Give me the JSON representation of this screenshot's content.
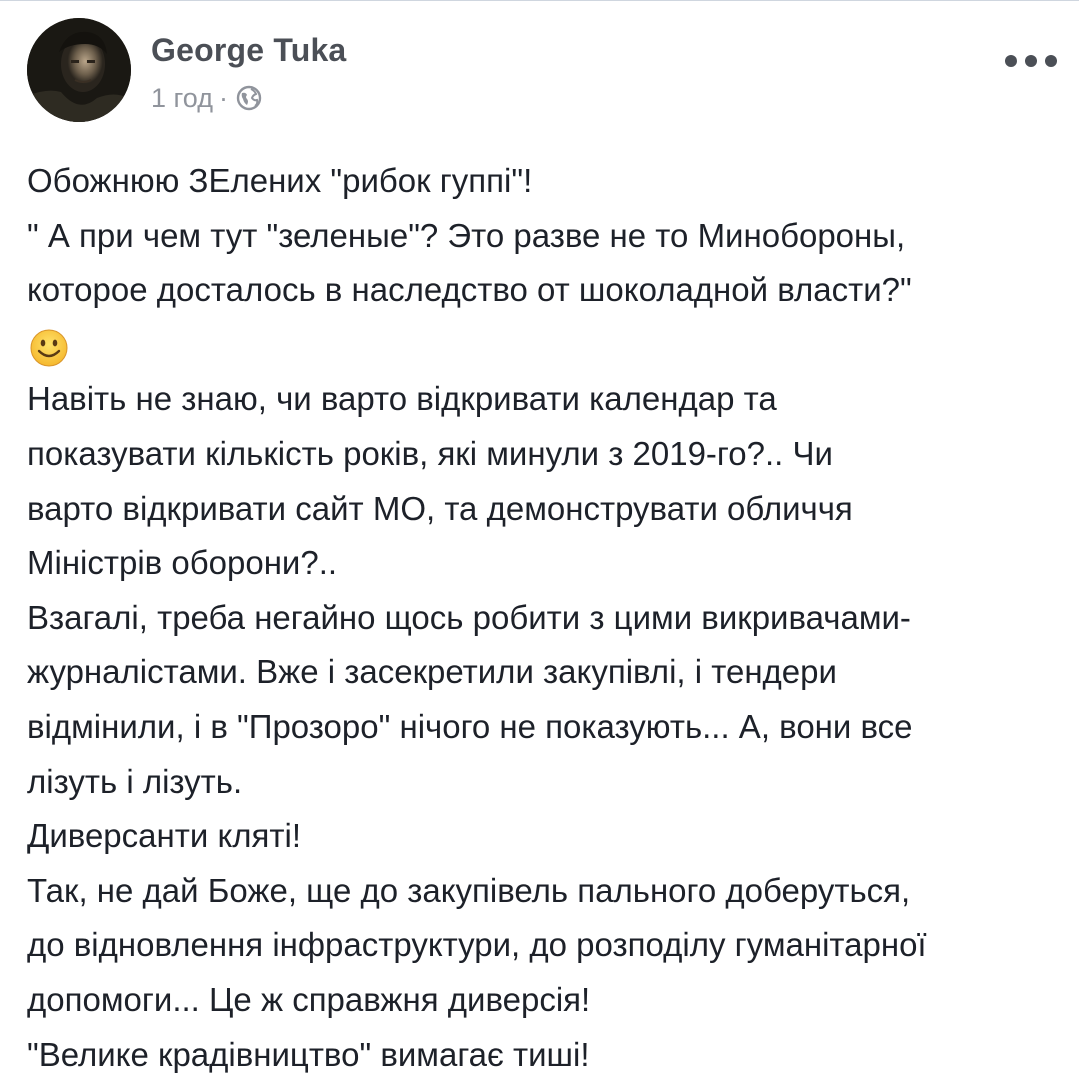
{
  "post": {
    "author": {
      "name": "George Tuka",
      "avatar_icon": "author-avatar"
    },
    "meta": {
      "time": "1 год",
      "separator": "·",
      "audience_icon": "globe-icon"
    },
    "menu_icon": "more-options-icon",
    "body_lines": [
      "Обожнюю ЗЕлених \"рибок гуппі\"!",
      "\" А при чем тут \"зеленые\"? Это разве не то Минобороны,",
      "которое досталось в наследство от шоколадной власти?\""
    ],
    "emoji": "smiling-face-emoji",
    "body_lines_2": [
      "Навіть не знаю, чи варто відкривати календар та",
      "показувати кількість років, які минули з 2019-го?.. Чи",
      "варто відкривати сайт МО, та демонструвати обличчя",
      "Міністрів оборони?..",
      "Взагалі, треба негайно щось робити з цими викривачами-",
      "журналістами. Вже і засекретили закупівлі, і тендери",
      "відмінили, і в \"Прозоро\" нічого не показують... А, вони все",
      "лізуть і лізуть.",
      "Диверсанти кляті!",
      "Так, не дай Боже, ще до закупівель пального доберуться,",
      "до відновлення інфраструктури, до розподілу гуманітарної",
      "допомоги... Це ж справжня диверсія!",
      "\"Велике крадівництво\" вимагає тиші!"
    ]
  }
}
